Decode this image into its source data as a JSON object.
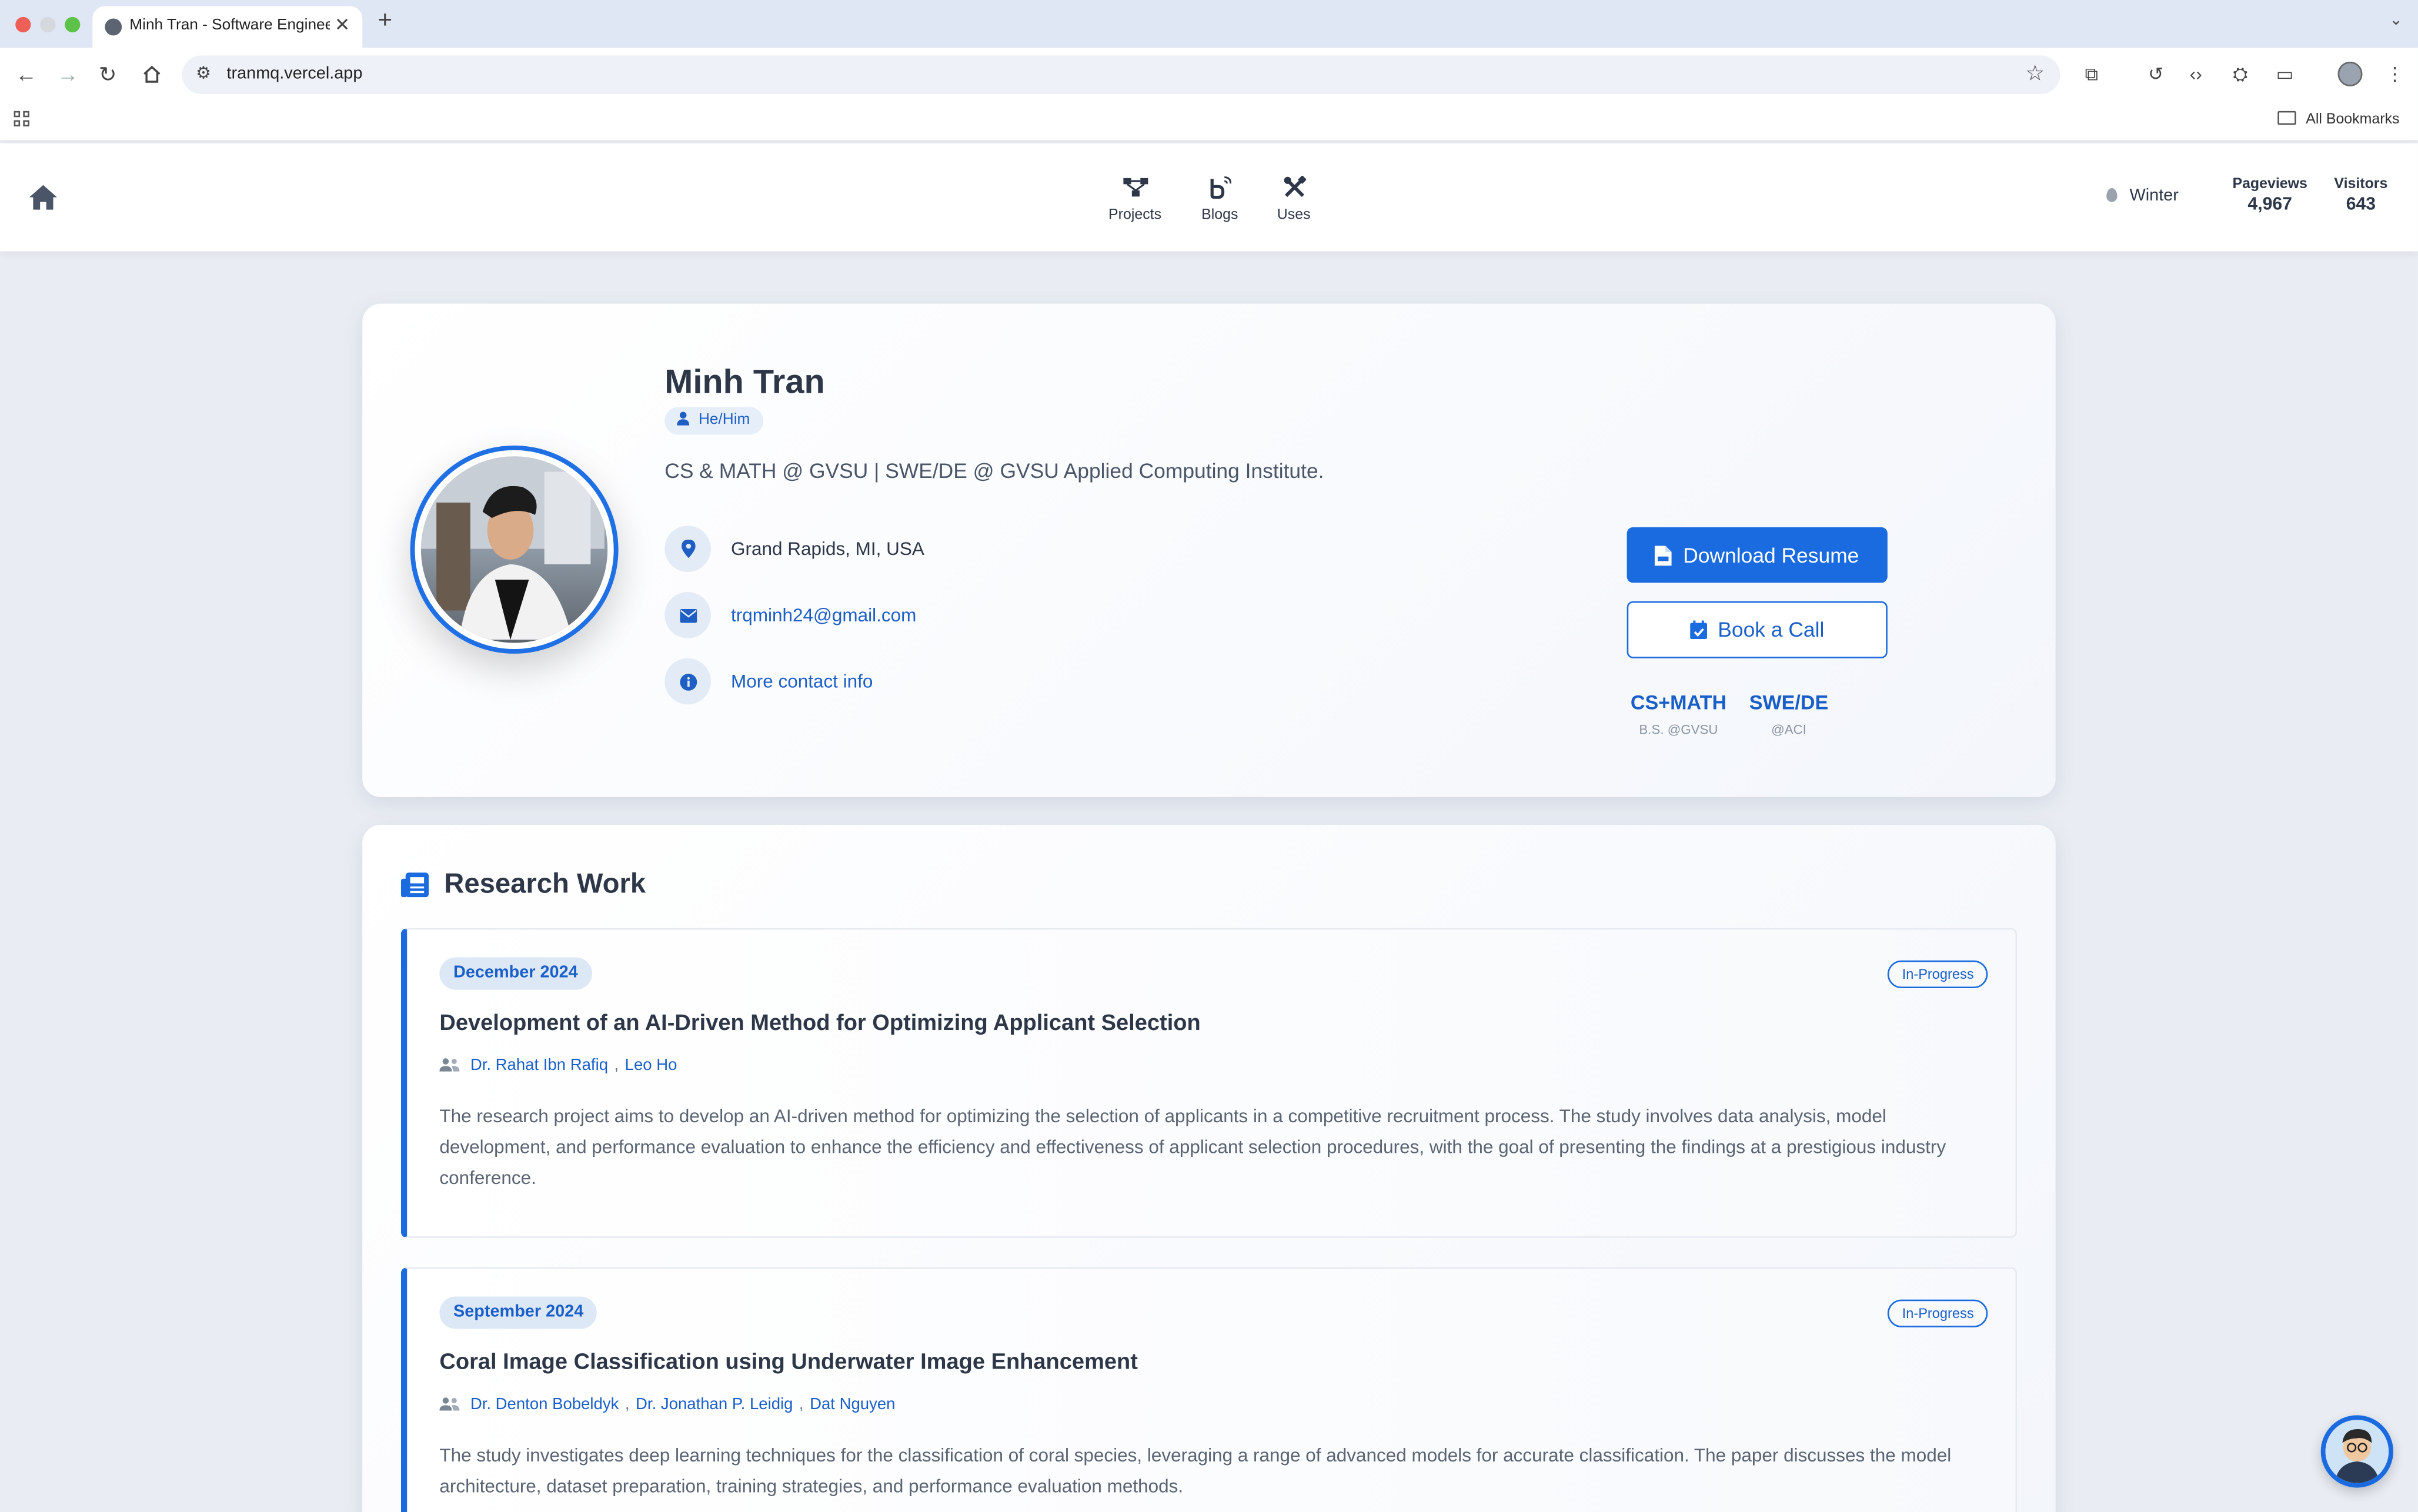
{
  "browser": {
    "tab_title": "Minh Tran - Software Engineer",
    "url": "tranmq.vercel.app",
    "bookmarks_label": "All Bookmarks"
  },
  "header": {
    "nav": [
      {
        "label": "Projects",
        "icon": "diagram-icon"
      },
      {
        "label": "Blogs",
        "icon": "blog-icon"
      },
      {
        "label": "Uses",
        "icon": "tools-icon"
      }
    ],
    "season": "Winter",
    "pageviews_label": "Pageviews",
    "pageviews": "4,967",
    "visitors_label": "Visitors",
    "visitors": "643"
  },
  "profile": {
    "name": "Minh Tran",
    "pronouns": "He/Him",
    "tagline": "CS & MATH @ GVSU | SWE/DE @ GVSU Applied Computing Institute.",
    "location": "Grand Rapids, MI, USA",
    "email": "trqminh24@gmail.com",
    "more_contact": "More contact info",
    "download_resume": "Download Resume",
    "book_call": "Book a Call",
    "degrees": [
      {
        "title": "CS+MATH",
        "sub": "B.S. @GVSU"
      },
      {
        "title": "SWE/DE",
        "sub": "@ACI"
      }
    ]
  },
  "research": {
    "title": "Research Work",
    "entries": [
      {
        "date": "December 2024",
        "status": "In-Progress",
        "title": "Development of an AI-Driven Method for Optimizing Applicant Selection",
        "authors": [
          "Dr. Rahat Ibn Rafiq",
          "Leo Ho"
        ],
        "abstract": "The research project aims to develop an AI-driven method for optimizing the selection of applicants in a competitive recruitment process. The study involves data analysis, model development, and performance evaluation to enhance the efficiency and effectiveness of applicant selection procedures, with the goal of presenting the findings at a prestigious industry conference."
      },
      {
        "date": "September 2024",
        "status": "In-Progress",
        "title": "Coral Image Classification using Underwater Image Enhancement",
        "authors": [
          "Dr. Denton Bobeldyk",
          "Dr. Jonathan P. Leidig",
          "Dat Nguyen"
        ],
        "abstract": "The study investigates deep learning techniques for the classification of coral species, leveraging a range of advanced models for accurate classification. The paper discusses the model architecture, dataset preparation, training strategies, and performance evaluation methods."
      }
    ]
  },
  "colors": {
    "accent": "#1a6be0",
    "text": "#2d3748",
    "muted": "#5a6472"
  }
}
